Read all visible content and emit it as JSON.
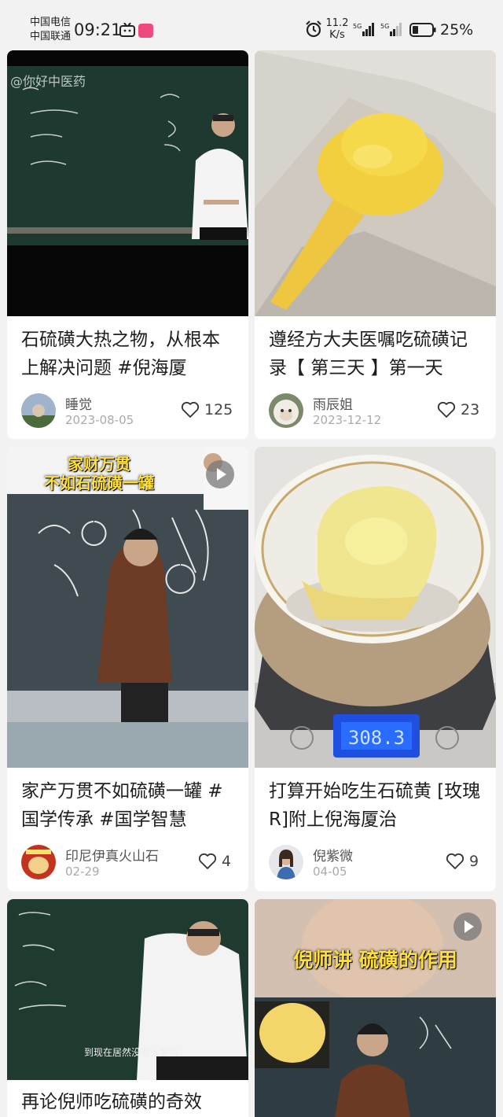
{
  "status_bar": {
    "carrier_1": "中国电信",
    "carrier_2": "中国联通",
    "time": "09:21",
    "net_speed_value": "11.2",
    "net_speed_unit": "K/s",
    "signal_1_label": "5G",
    "signal_2_label": "5G",
    "battery": "25%",
    "icons": [
      "tv-icon",
      "app-icon",
      "alarm-icon",
      "signal-icon",
      "signal-icon",
      "battery-icon"
    ]
  },
  "feed": {
    "cards": [
      {
        "title": "石硫磺大热之物，从根本上解决问题 #倪海厦",
        "author": "睡觉",
        "date": "2023-08-05",
        "likes": "125",
        "watermark": "@你好中医药"
      },
      {
        "title": "遵经方大夫医嘱吃硫磺记录【 第三天 】第一天",
        "author": "雨辰姐",
        "date": "2023-12-12",
        "likes": "23"
      },
      {
        "title": "家产万贯不如硫磺一罐 #国学传承 #国学智慧",
        "author": "印尼伊真火山石",
        "date": "02-29",
        "likes": "4",
        "caption_line_1": "家财万贯",
        "caption_line_2": "不如石硫磺一罐",
        "is_video": true
      },
      {
        "title": "打算开始吃生石硫黄 [玫瑰R]附上倪海厦治",
        "author": "倪紫微",
        "date": "04-05",
        "likes": "9",
        "scale_reading": "308.3"
      },
      {
        "title": "再论倪师吃硫磺的奇效",
        "subtitle": "到现在居然没有人会用"
      },
      {
        "caption": "倪师讲 硫磺的作用",
        "is_video": true
      }
    ]
  }
}
